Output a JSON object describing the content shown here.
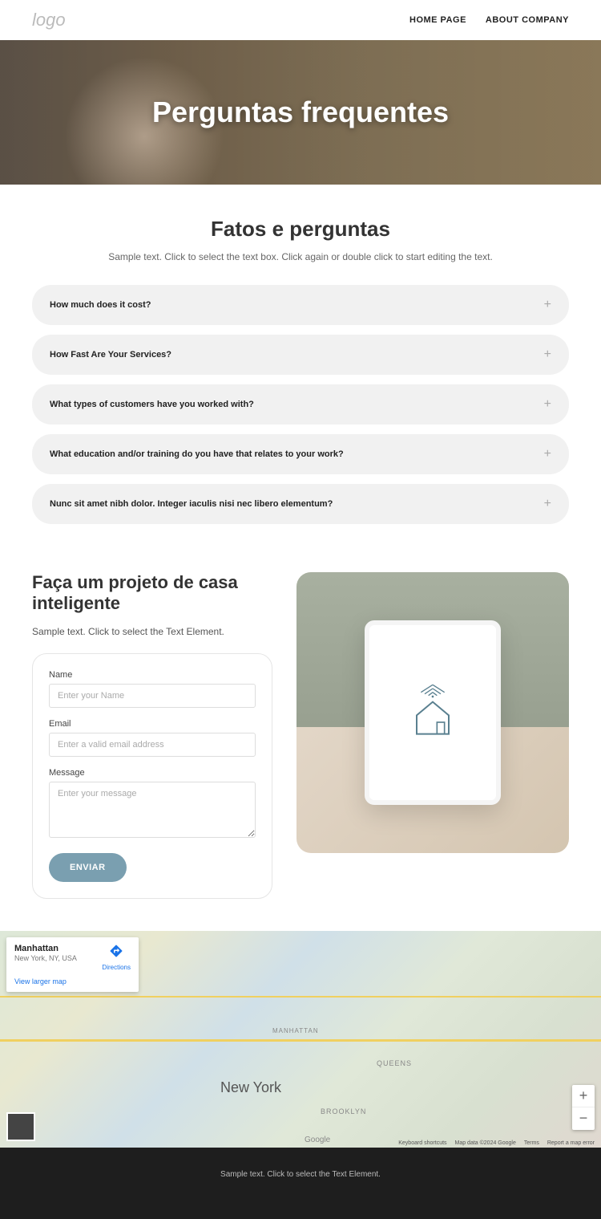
{
  "header": {
    "logo": "logo",
    "nav": {
      "home": "HOME PAGE",
      "about": "ABOUT COMPANY"
    }
  },
  "hero": {
    "title": "Perguntas frequentes"
  },
  "faq": {
    "heading": "Fatos e perguntas",
    "subtitle": "Sample text. Click to select the text box. Click again or double click to start editing the text.",
    "items": [
      "How much does it cost?",
      "How Fast Are Your Services?",
      "What types of customers have you worked with?",
      "What education and/or training do you have that relates to your work?",
      "Nunc sit amet nibh dolor. Integer iaculis nisi nec libero elementum?"
    ]
  },
  "contact": {
    "heading": "Faça um projeto de casa inteligente",
    "subtext": "Sample text. Click to select the Text Element.",
    "form": {
      "name_label": "Name",
      "name_placeholder": "Enter your Name",
      "email_label": "Email",
      "email_placeholder": "Enter a valid email address",
      "message_label": "Message",
      "message_placeholder": "Enter your message",
      "submit": "ENVIAR"
    }
  },
  "map": {
    "card_title": "Manhattan",
    "card_sub": "New York, NY, USA",
    "card_link": "View larger map",
    "directions": "Directions",
    "city_label": "New York",
    "brooklyn": "BROOKLYN",
    "manhattan": "MANHATTAN",
    "queens": "QUEENS",
    "zoom_in": "+",
    "zoom_out": "−",
    "shortcuts": "Keyboard shortcuts",
    "mapdata": "Map data ©2024 Google",
    "terms": "Terms",
    "report": "Report a map error",
    "google": "Google"
  },
  "footer": {
    "text": "Sample text. Click to select the Text Element."
  }
}
